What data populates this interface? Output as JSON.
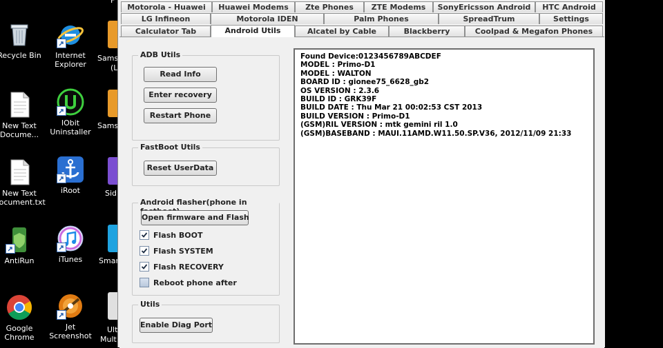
{
  "desktop": {
    "col1": [
      {
        "label": "Recycle Bin",
        "icon": "recycle-bin-icon"
      },
      {
        "label": "New Text\nDocume...",
        "icon": "text-document-icon"
      },
      {
        "label": "New Text\nDocument.txt",
        "icon": "text-document-icon"
      },
      {
        "label": "AntiRun",
        "icon": "antirun-icon"
      },
      {
        "label": "Google\nChrome",
        "icon": "chrome-icon"
      }
    ],
    "col2": [
      {
        "label": "Internet\nExplorer",
        "icon": "internet-explorer-icon"
      },
      {
        "label": "IObit\nUninstaller",
        "icon": "iobit-uninstaller-icon"
      },
      {
        "label": "iRoot",
        "icon": "anchor-icon"
      },
      {
        "label": "iTunes",
        "icon": "itunes-icon"
      },
      {
        "label": "Jet\nScreenshot",
        "icon": "jet-screenshot-icon"
      }
    ],
    "col3_partial": [
      {
        "label": "Samsu"
      },
      {
        "label": "(L"
      },
      {
        "label": "Samsu"
      },
      {
        "label": "Sid"
      },
      {
        "label": "Smar"
      },
      {
        "label": "Ult"
      },
      {
        "label": "Mult"
      }
    ],
    "top_partial": "F"
  },
  "tabs": {
    "row1": [
      "Motorola - Huawei",
      "Huawei Modems",
      "Zte Phones",
      "ZTE Modems",
      "SonyEricsson Android",
      "HTC Android"
    ],
    "row2": [
      "LG Infineon",
      "Motorola IDEN",
      "Palm Phones",
      "SpreadTrum",
      "Settings"
    ],
    "row3": [
      "Calculator Tab",
      "Android Utils",
      "Alcatel by Cable",
      "Blackberry",
      "Coolpad & Megafon Phones"
    ],
    "active": "Android Utils"
  },
  "adb_utils": {
    "title": "ADB Utils",
    "read_info": "Read Info",
    "enter_recovery": "Enter recovery",
    "restart_phone": "Restart Phone"
  },
  "fastboot_utils": {
    "title": "FastBoot Utils",
    "reset_userdata": "Reset UserData"
  },
  "android_flasher": {
    "title": "Android flasher(phone in fastboot)",
    "open_firmware": "Open firmware and Flash",
    "options": [
      {
        "label": "Flash BOOT",
        "checked": true
      },
      {
        "label": "Flash SYSTEM",
        "checked": true
      },
      {
        "label": "Flash RECOVERY",
        "checked": true
      },
      {
        "label": "Reboot phone after",
        "checked": false
      }
    ]
  },
  "utils": {
    "title": "Utils",
    "enable_diag": "Enable Diag Port"
  },
  "log": [
    "Found Device:0123456789ABCDEF",
    "MODEL : Primo-D1",
    "MODEL : WALTON",
    "BOARD ID : gionee75_6628_gb2",
    "OS VERSION : 2.3.6",
    "BUILD ID : GRK39F",
    "BUILD DATE : Thu Mar 21 00:02:53 CST 2013",
    "BUILD VERSION : Primo-D1",
    "(GSM)RIL VERSION : mtk gemini ril 1.0",
    "(GSM)BASEBAND : MAUI.11AMD.W11.50.SP.V36, 2012/11/09 21:33"
  ]
}
